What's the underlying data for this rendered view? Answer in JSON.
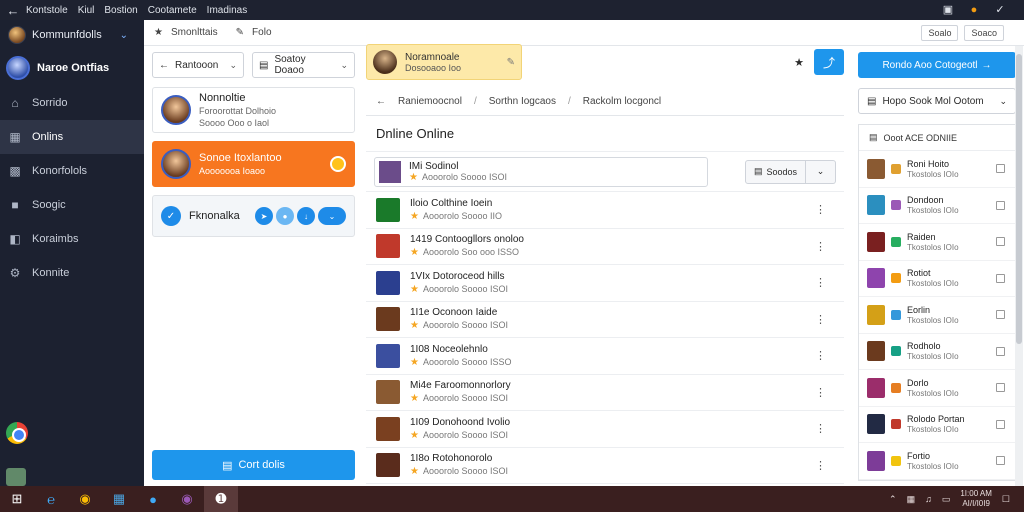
{
  "titlebar": {
    "menu": [
      "Kontstole",
      "Kiul",
      "Bostion",
      "Cootamete",
      "Imadinas"
    ]
  },
  "sidebar": {
    "header": "Kommunfdolls",
    "user": "Naroe Ontfias",
    "items": [
      {
        "label": "Sorrido",
        "icon": "home-icon"
      },
      {
        "label": "Onlins",
        "icon": "online-icon"
      },
      {
        "label": "Konorfolols",
        "icon": "contacts-icon"
      },
      {
        "label": "Soogic",
        "icon": "lock-icon"
      },
      {
        "label": "Koraimbs",
        "icon": "bookmark-icon"
      },
      {
        "label": "Konnite",
        "icon": "settings-icon"
      }
    ]
  },
  "topbar": {
    "tab1": "Smonlttais",
    "tab2": "Folo",
    "right1": "Soalo",
    "right2": "Soaco"
  },
  "left": {
    "select1": "Rantooon",
    "select2": "Soatoy Doaoo",
    "card1": {
      "title": "Nonnoltie",
      "line2": "Foroorottat Dolhoio",
      "line3": "Soooo Ooo o Iaol"
    },
    "card2": {
      "title": "Sonoe Itoxlantoo",
      "line2": "Aooooooa Ioaoo"
    },
    "card3": {
      "title": "Fknonalka"
    },
    "cta": "Cort dolis"
  },
  "center": {
    "yellow_card": {
      "title": "Noramnoale",
      "sub": "Dosooaoo Ioo"
    },
    "breadcrumb": [
      "Raniemoocnol",
      "Sorthn Iogcaos",
      "Rackolm locgoncl"
    ],
    "section_title": "Dnline Online",
    "search": {
      "title": "IMi Sodinol",
      "sub": "Aooorolo Soooo ISOI"
    },
    "filter_label": "Soodos",
    "rows": [
      {
        "title": "Iloio Colthine Ioein",
        "sub": "Aooorolo Soooo IIO",
        "color": "#1a7a2a"
      },
      {
        "title": "1419 Contoogllors onoloo",
        "sub": "Aooorolo Soo ooo ISSO",
        "color": "#c0392b"
      },
      {
        "title": "1VIx Dotoroceod hills",
        "sub": "Aooorolo Soooo ISOI",
        "color": "#2b3f8f"
      },
      {
        "title": "1I1e Oconoon Iaide",
        "sub": "Aooorolo Soooo ISOI",
        "color": "#6b3a1e"
      },
      {
        "title": "1I08 Noceolehnlo",
        "sub": "Aooorolo Soooo ISSO",
        "color": "#3b4f9f"
      },
      {
        "title": "Mi4e Faroomonnorlory",
        "sub": "Aooorolo Soooo ISOI",
        "color": "#8a5a32"
      },
      {
        "title": "1I09 Donohoond Ivolio",
        "sub": "Aooorolo Soooo ISOI",
        "color": "#7a4020"
      },
      {
        "title": "1I8o Rotohonorolo",
        "sub": "Aooorolo Soooo ISOI",
        "color": "#5a2c1c"
      }
    ]
  },
  "right": {
    "action": "Rondo Aoo Cotogeotl",
    "select": "Hopo Sook Mol Ootom",
    "panel_header": "Ooot ACE ODNIIE",
    "rows": [
      {
        "title": "Roni Hoito",
        "sub": "Tkostolos IOIo",
        "color": "#8a5a32",
        "mini": "#e0a030"
      },
      {
        "title": "Dondoon",
        "sub": "Tkostolos IOIo",
        "color": "#2b8fbf",
        "mini": "#9b59b6"
      },
      {
        "title": "Raiden",
        "sub": "Tkostolos IOIo",
        "color": "#7a2020",
        "mini": "#27ae60"
      },
      {
        "title": "Rotiot",
        "sub": "Tkostolos IOIo",
        "color": "#8e44ad",
        "mini": "#f39c12"
      },
      {
        "title": "Eorlin",
        "sub": "Tkostolos IOIo",
        "color": "#d4a017",
        "mini": "#3498db"
      },
      {
        "title": "Rodholo",
        "sub": "Tkostolos IOIo",
        "color": "#6b3a1e",
        "mini": "#16a085"
      },
      {
        "title": "Dorlo",
        "sub": "Tkostolos IOIo",
        "color": "#9b2d6b",
        "mini": "#e67e22"
      },
      {
        "title": "Rolodo Portan",
        "sub": "Tkostolos IOIo",
        "color": "#222a44",
        "mini": "#c0392b"
      },
      {
        "title": "Fortio",
        "sub": "Tkostolos IOIo",
        "color": "#7d3c98",
        "mini": "#f1c40f"
      }
    ]
  },
  "taskbar": {
    "time": "1I:00 AM",
    "date": "AI/I/I0I9"
  },
  "colors": {
    "accent": "#1e96ec",
    "orange": "#f7761f",
    "sidebar": "#1c2130"
  }
}
